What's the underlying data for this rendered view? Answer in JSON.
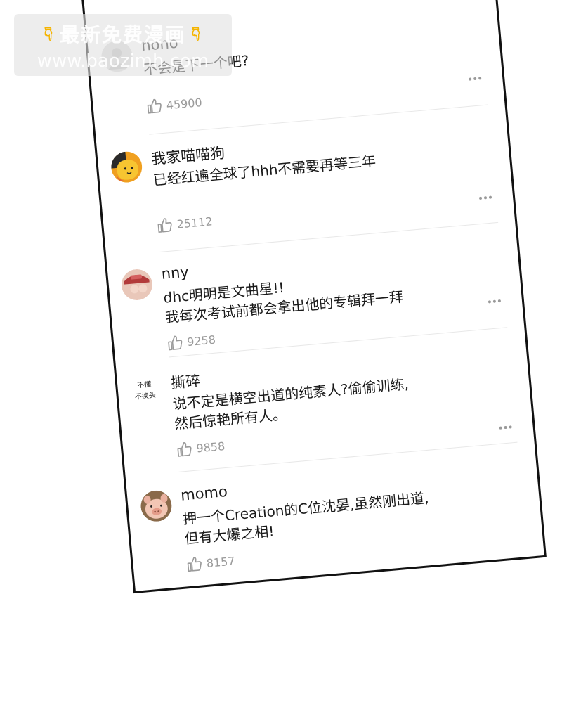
{
  "watermark": {
    "title": "最新免费漫画",
    "url": "www.baozimh.com",
    "hand_icon": "pointing-down-hand-icon"
  },
  "comments": [
    {
      "username": "nono",
      "lines": [
        "不会是下一个吧?"
      ],
      "likes": "45900"
    },
    {
      "username": "我家喵喵狗",
      "lines": [
        "已经红遍全球了hhh不需要再等三年"
      ],
      "likes": "25112"
    },
    {
      "username": "nny",
      "lines": [
        "dhc明明是文曲星!!",
        "我每次考试前都会拿出他的专辑拜一拜"
      ],
      "likes": "9258"
    },
    {
      "username": "撕碎",
      "avatar_text": [
        "不懂",
        "不换头"
      ],
      "lines": [
        "说不定是横空出道的纯素人?偷偷训练,",
        "然后惊艳所有人。"
      ],
      "likes": "9858"
    },
    {
      "username": "momo",
      "lines": [
        "押一个Creation的C位沈晏,虽然刚出道,",
        "但有大爆之相!"
      ],
      "likes": "8157"
    }
  ],
  "icons": {
    "like": "thumbs-up-icon",
    "more": "more-options-icon"
  },
  "colors": {
    "text": "#1a1a1a",
    "muted": "#9a9a9a",
    "border": "#111111",
    "watermark_hand": "#f5b400"
  }
}
